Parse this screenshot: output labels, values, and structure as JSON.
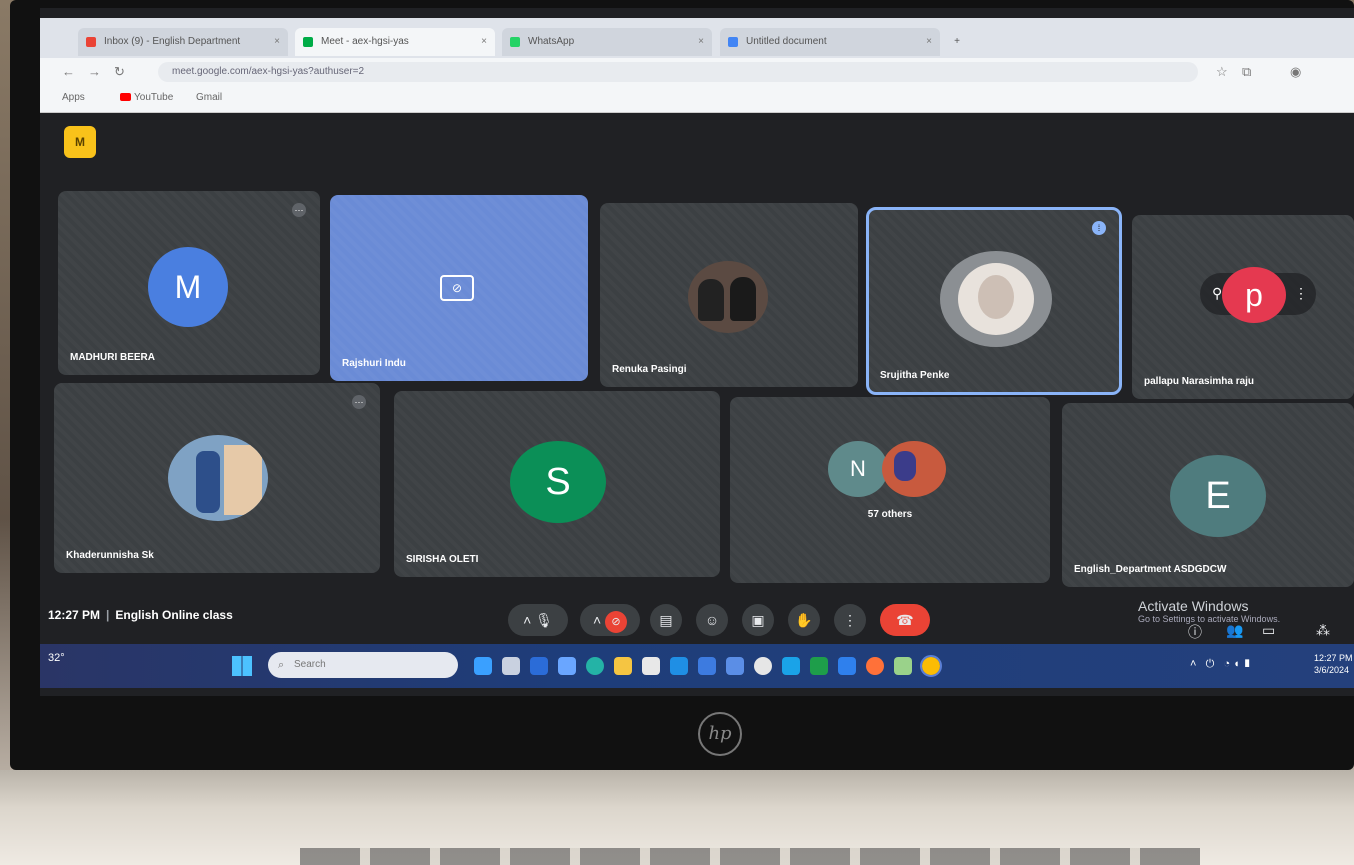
{
  "browser": {
    "tabs": [
      {
        "title": "Inbox (9) - English Department",
        "color": "#ea4335"
      },
      {
        "title": "Meet - aex-hgsi-yas",
        "color": "#00ac47"
      },
      {
        "title": "WhatsApp",
        "color": "#25d366"
      },
      {
        "title": "Untitled document",
        "color": "#4285f4"
      }
    ],
    "url": "meet.google.com/aex-hgsi-yas?authuser=2",
    "bookmarks": [
      "Apps",
      "YouTube",
      "Gmail"
    ]
  },
  "meet": {
    "logo_label": "M",
    "tiles": [
      {
        "name": "MADHURI BEERA",
        "initial": "M",
        "color": "#4a7fe0",
        "kind": "initial"
      },
      {
        "name": "Rajshuri Indu",
        "kind": "camera-off"
      },
      {
        "name": "Renuka Pasingi",
        "kind": "photo",
        "photo_bg": "#5b4a42"
      },
      {
        "name": "Srujitha Penke",
        "kind": "photo",
        "photo_bg": "#d9d2cc"
      },
      {
        "name": "pallapu Narasimha raju",
        "initial": "p",
        "color": "#e53950",
        "kind": "initial"
      },
      {
        "name": "Khaderunnisha Sk",
        "kind": "photo",
        "photo_bg": "#7fa2c4"
      },
      {
        "name": "SIRISHA OLETI",
        "initial": "S",
        "color": "#0b8f57",
        "kind": "initial"
      },
      {
        "name": "57 others",
        "initial": "N",
        "color": "#5f8a8b",
        "kind": "group"
      },
      {
        "name": "English_Department ASDGDCW",
        "initial": "E",
        "color": "#4f7c7e",
        "kind": "initial"
      }
    ],
    "bottom_bar": {
      "time": "12:27 PM",
      "meeting_name": "English Online class"
    }
  },
  "windows": {
    "activate_title": "Activate Windows",
    "activate_sub": "Go to Settings to activate Windows.",
    "search_placeholder": "Search",
    "weather": "32°",
    "clock_time": "12:27 PM",
    "clock_date": "3/6/2024"
  },
  "laptop_brand": "hp"
}
